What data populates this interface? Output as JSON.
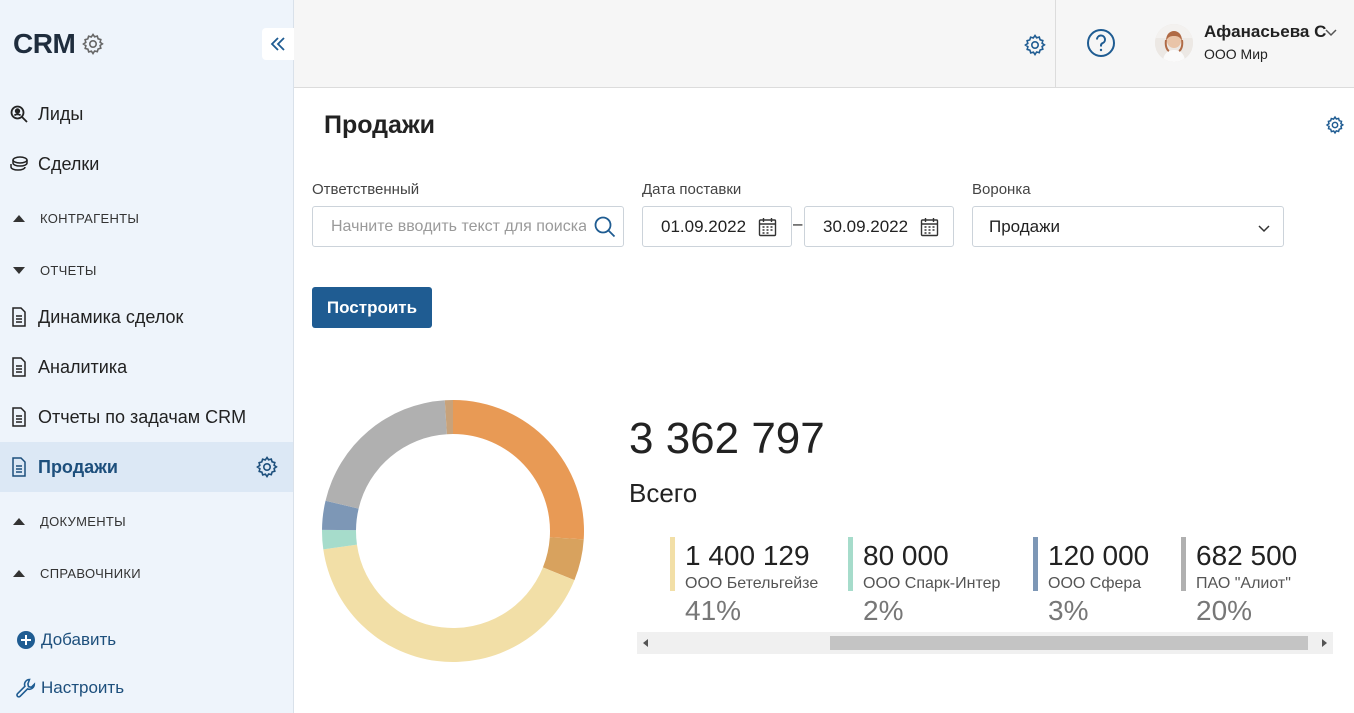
{
  "sidebar": {
    "brand": "CRM",
    "items": [
      {
        "label": "Лиды",
        "icon": "search-person-icon"
      },
      {
        "label": "Сделки",
        "icon": "coins-icon"
      },
      {
        "label": "Динамика сделок",
        "icon": "document-icon"
      },
      {
        "label": "Аналитика",
        "icon": "document-icon"
      },
      {
        "label": "Отчеты по задачам CRM",
        "icon": "document-icon"
      },
      {
        "label": "Продажи",
        "icon": "document-icon",
        "active": true
      }
    ],
    "groups": {
      "contractors": "КОНТРАГЕНТЫ",
      "reports": "ОТЧЕТЫ",
      "documents": "ДОКУМЕНТЫ",
      "directories": "СПРАВОЧНИКИ"
    },
    "add_label": "Добавить",
    "configure_label": "Настроить"
  },
  "user": {
    "name": "Афанасьева С",
    "org": "ООО Мир"
  },
  "page": {
    "title": "Продажи"
  },
  "filters": {
    "responsible_label": "Ответственный",
    "responsible_placeholder": "Начните вводить текст для поиска",
    "date_label": "Дата поставки",
    "date_from": "01.09.2022",
    "date_sep": "–",
    "date_to": "30.09.2022",
    "funnel_label": "Воронка",
    "funnel_value": "Продажи",
    "build_label": "Построить"
  },
  "summary": {
    "total_value": "3 362 797",
    "total_label": "Всего"
  },
  "chart_data": {
    "type": "pie",
    "title": "",
    "total": 3362797,
    "series": [
      {
        "name": "ООО Бетельгейзе",
        "display_value": "1 400 129",
        "value": 1400129,
        "percent_label": "41%",
        "color": "#f2dfa7"
      },
      {
        "name": "ООО Спарк-Интер",
        "display_value": "80 000",
        "value": 80000,
        "percent_label": "2%",
        "color": "#a6dccb"
      },
      {
        "name": "ООО Сфера",
        "display_value": "120 000",
        "value": 120000,
        "percent_label": "3%",
        "color": "#7d97b6"
      },
      {
        "name": "ПАО \"Алиот\"",
        "display_value": "682 500",
        "value": 682500,
        "percent_label": "20%",
        "color": "#b0b0b0"
      },
      {
        "name": "",
        "value": 33628,
        "color": "#c8a27a"
      },
      {
        "name": "",
        "value": 875000,
        "color": "#e89a55"
      },
      {
        "name": "",
        "value": 171540,
        "color": "#d8a25e"
      }
    ]
  },
  "colors": {
    "accent": "#1f5c92",
    "sidebar_bg": "#eef4fb",
    "active_bg": "#dce8f5"
  }
}
